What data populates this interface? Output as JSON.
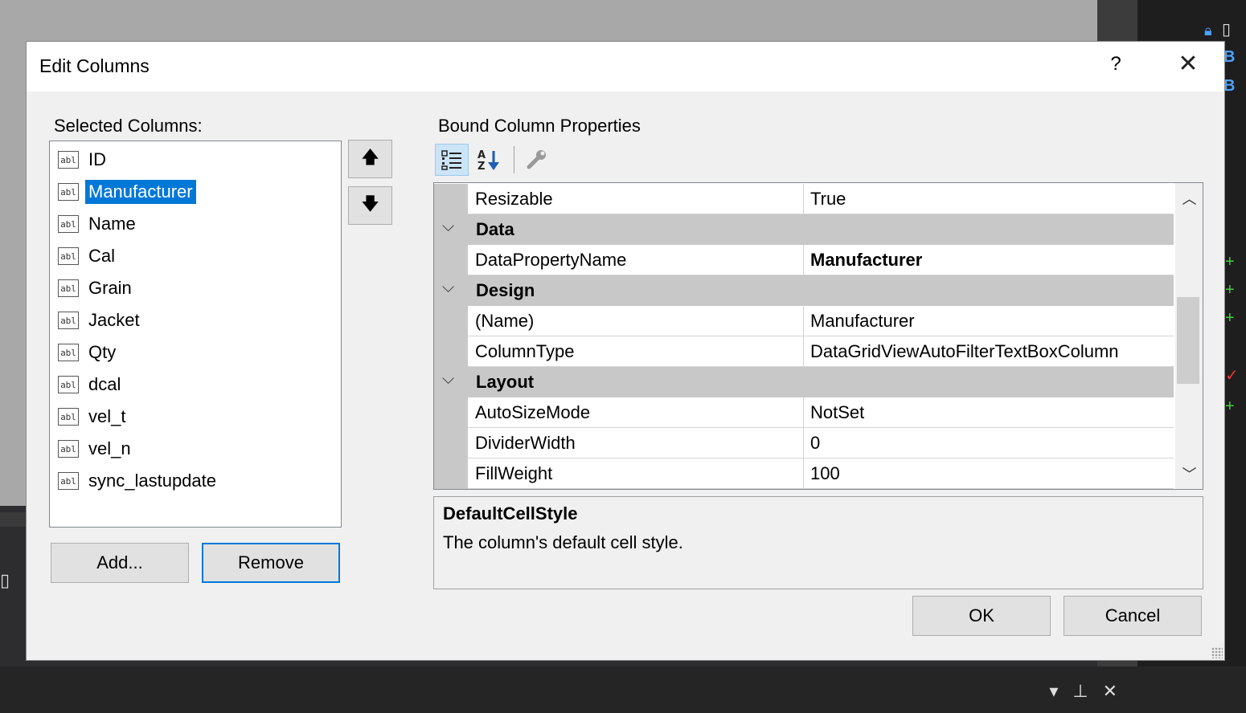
{
  "dialog": {
    "title": "Edit Columns",
    "help_label": "?",
    "close_label": "✕"
  },
  "selected_columns": {
    "label": "Selected Columns:",
    "icon_text": "abl",
    "items": [
      {
        "name": "ID",
        "selected": false
      },
      {
        "name": "Manufacturer",
        "selected": true
      },
      {
        "name": "Name",
        "selected": false
      },
      {
        "name": "Cal",
        "selected": false
      },
      {
        "name": "Grain",
        "selected": false
      },
      {
        "name": "Jacket",
        "selected": false
      },
      {
        "name": "Qty",
        "selected": false
      },
      {
        "name": "dcal",
        "selected": false
      },
      {
        "name": "vel_t",
        "selected": false
      },
      {
        "name": "vel_n",
        "selected": false
      },
      {
        "name": "sync_lastupdate",
        "selected": false
      }
    ],
    "move_up_label": "🡅",
    "move_down_label": "🡇"
  },
  "buttons": {
    "add": "Add...",
    "remove": "Remove",
    "ok": "OK",
    "cancel": "Cancel"
  },
  "properties": {
    "label": "Bound Column Properties",
    "toolbar": {
      "categorized_icon": "categorized-icon",
      "alphabetical_icon": "sort-az-icon",
      "property_pages_icon": "wrench-icon"
    },
    "rows": [
      {
        "type": "prop",
        "name": "Resizable",
        "value": "True",
        "bold": false
      },
      {
        "type": "cat",
        "name": "Data"
      },
      {
        "type": "prop",
        "name": "DataPropertyName",
        "value": "Manufacturer",
        "bold": true
      },
      {
        "type": "cat",
        "name": "Design"
      },
      {
        "type": "prop",
        "name": "(Name)",
        "value": "Manufacturer",
        "bold": false
      },
      {
        "type": "prop",
        "name": "ColumnType",
        "value": "DataGridViewAutoFilterTextBoxColumn",
        "bold": false
      },
      {
        "type": "cat",
        "name": "Layout"
      },
      {
        "type": "prop",
        "name": "AutoSizeMode",
        "value": "NotSet",
        "bold": false
      },
      {
        "type": "prop",
        "name": "DividerWidth",
        "value": "0",
        "bold": false
      },
      {
        "type": "prop",
        "name": "FillWeight",
        "value": "100",
        "bold": false
      }
    ],
    "description": {
      "title": "DefaultCellStyle",
      "text": "The column's default cell style."
    }
  },
  "colors": {
    "selection": "#0078d7",
    "category_bg": "#c8c8c8",
    "dialog_bg": "#f0f0f0"
  }
}
